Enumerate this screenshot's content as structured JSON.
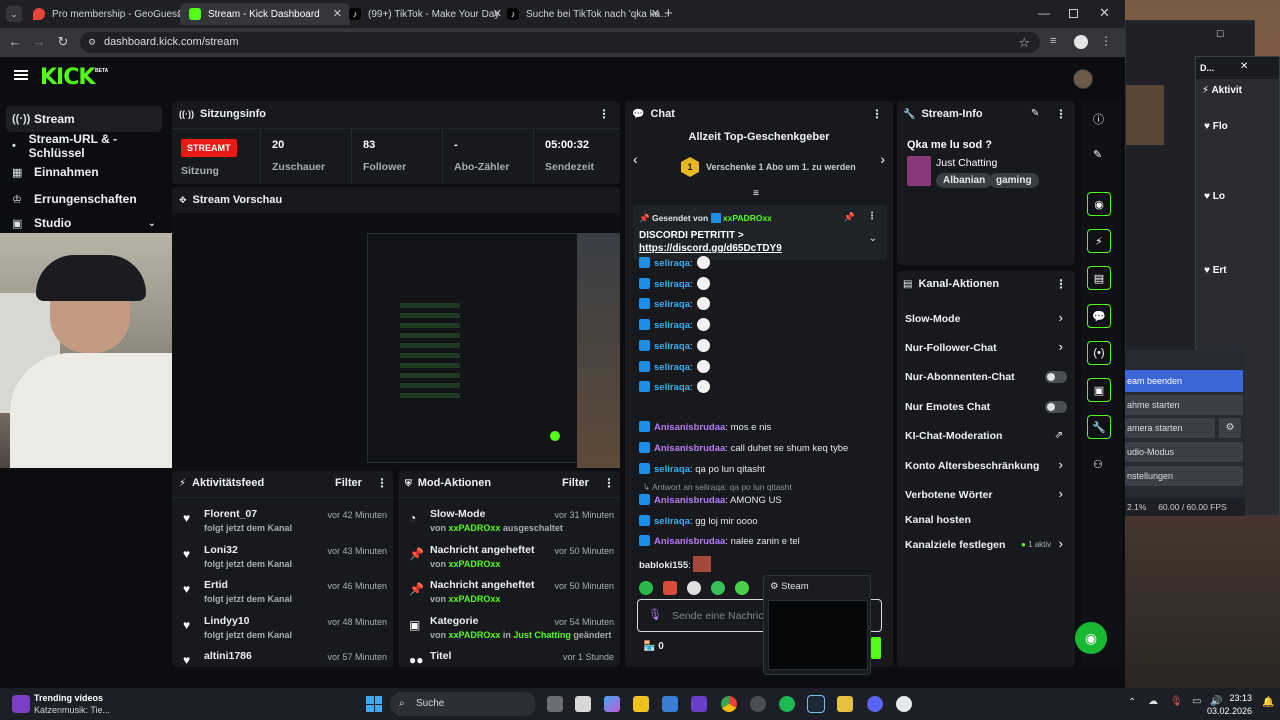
{
  "browser": {
    "tabs": [
      {
        "title": "Pro membership - GeoGuessr",
        "color": "#e8443a"
      },
      {
        "title": "Stream - Kick Dashboard",
        "color": "#53fc18"
      },
      {
        "title": "(99+) TikTok - Make Your Day",
        "color": "#111111"
      },
      {
        "title": "Suche bei TikTok nach 'qka ka…",
        "color": "#111111"
      }
    ],
    "url": "dashboard.kick.com/stream"
  },
  "kick": {
    "logo": "KICK",
    "beta": "BETA"
  },
  "nav": {
    "items": [
      "Stream",
      "Stream-URL & -Schlüssel",
      "Einnahmen",
      "Errungenschaften",
      "Studio"
    ]
  },
  "session": {
    "title": "Sitzungsinfo",
    "badge": "STREAMT",
    "sitzung": "Sitzung",
    "viewers": "20",
    "viewers_label": "Zuschauer",
    "followers": "83",
    "followers_label": "Follower",
    "subs": "-",
    "subs_label": "Abo-Zähler",
    "time": "05:00:32",
    "time_label": "Sendezeit"
  },
  "preview": {
    "title": "Stream Vorschau"
  },
  "activity": {
    "title": "Aktivitätsfeed",
    "filter": "Filter",
    "items": [
      {
        "name": "Florent_07",
        "sub": "folgt jetzt dem Kanal",
        "time": "vor 42 Minuten"
      },
      {
        "name": "Loni32",
        "sub": "folgt jetzt dem Kanal",
        "time": "vor 43 Minuten"
      },
      {
        "name": "Ertid",
        "sub": "folgt jetzt dem Kanal",
        "time": "vor 46 Minuten"
      },
      {
        "name": "Lindyy10",
        "sub": "folgt jetzt dem Kanal",
        "time": "vor 48 Minuten"
      },
      {
        "name": "altini1786",
        "sub": "",
        "time": "vor 57 Minuten"
      }
    ]
  },
  "mod": {
    "title": "Mod-Aktionen",
    "filter": "Filter",
    "items": [
      {
        "name": "Slow-Mode",
        "pre": "von ",
        "user": "xxPADROxx",
        "post": " ausgeschaltet",
        "extra": "",
        "time": "vor 31 Minuten"
      },
      {
        "name": "Nachricht angeheftet",
        "pre": "von ",
        "user": "xxPADROxx",
        "post": "",
        "extra": "",
        "time": "vor 50 Minuten"
      },
      {
        "name": "Nachricht angeheftet",
        "pre": "von ",
        "user": "xxPADROxx",
        "post": "",
        "extra": "",
        "time": "vor 50 Minuten"
      },
      {
        "name": "Kategorie",
        "pre": "von ",
        "user": "xxPADROxx",
        "post": " in ",
        "extra": "Just Chatting",
        "post2": " geändert",
        "time": "vor 54 Minuten"
      },
      {
        "name": "Titel",
        "pre": "",
        "user": "",
        "post": "",
        "extra": "",
        "time": "vor 1 Stunde"
      }
    ]
  },
  "chat": {
    "title": "Chat",
    "gifter_title": "Allzeit Top-Geschenkgeber",
    "gift_text": "Verschenke 1 Abo um 1. zu werden",
    "gift_rank": "1",
    "pinned_by": "Gesendet von",
    "pinned_user": "xxPADROxx",
    "pinned_msg": "DISCORDI PETRITIT >",
    "pinned_link": "https://discord.gg/d65DcTDY9",
    "messages": [
      {
        "user": "seliraqa",
        "text": "",
        "color": "blue",
        "emote": true
      },
      {
        "user": "seliraqa",
        "text": "",
        "color": "blue",
        "emote": true
      },
      {
        "user": "seliraqa",
        "text": "",
        "color": "blue",
        "emote": true
      },
      {
        "user": "seliraqa",
        "text": "",
        "color": "blue",
        "emote": true
      },
      {
        "user": "seliraqa",
        "text": "",
        "color": "blue",
        "emote": true
      },
      {
        "user": "seliraqa",
        "text": "",
        "color": "blue",
        "emote": true
      },
      {
        "user": "seliraqa",
        "text": "",
        "color": "blue",
        "emote": true
      },
      {
        "user": "Anisanisbrudaa",
        "text": "mos e nis",
        "color": "purple",
        "emote": false
      },
      {
        "user": "Anisanisbrudaa",
        "text": "call duhet se shum keq tybe",
        "color": "purple",
        "emote": false
      },
      {
        "user": "seliraqa",
        "text": "qa po lun qitasht",
        "color": "blue",
        "emote": false
      },
      {
        "user": "Anisanisbrudaa",
        "text": "AMONG US",
        "color": "purple",
        "emote": false
      },
      {
        "user": "seliraqa",
        "text": "gg loj mir oooo",
        "color": "blue",
        "emote": false
      },
      {
        "user": "Anisanisbrudaa",
        "text": "nalee zanin e tel",
        "color": "purple",
        "emote": false
      },
      {
        "user": "babloki155",
        "text": "",
        "color": "plain",
        "emote": false
      }
    ],
    "reply_hint": "Antwort an seliraqa: qa po lun qitasht",
    "input_placeholder": "Sende eine Nachricht",
    "count": "0"
  },
  "steam_popup": {
    "label": "Steam"
  },
  "info": {
    "title": "Stream-Info",
    "stream_title": "Qka me lu sod ?",
    "category": "Just Chatting",
    "tags": [
      "Albanian",
      "gaming"
    ]
  },
  "actions": {
    "title": "Kanal-Aktionen",
    "items": [
      {
        "label": "Slow-Mode",
        "kind": "chev"
      },
      {
        "label": "Nur-Follower-Chat",
        "kind": "chev"
      },
      {
        "label": "Nur-Abonnenten-Chat",
        "kind": "toggle"
      },
      {
        "label": "Nur Emotes Chat",
        "kind": "toggle"
      },
      {
        "label": "KI-Chat-Moderation",
        "kind": "ext"
      },
      {
        "label": "Konto Altersbeschränkung",
        "kind": "chev"
      },
      {
        "label": "Verbotene Wörter",
        "kind": "chev"
      },
      {
        "label": "Kanal hosten",
        "kind": "none"
      },
      {
        "label": "Kanalziele festlegen",
        "kind": "chev"
      }
    ],
    "goal_active": "1 aktiv"
  },
  "obs": {
    "title": "D...",
    "activity_label": "Aktivit",
    "list": [
      {
        "t": "Flo"
      },
      {
        "t": "Lo"
      },
      {
        "t": "Ert"
      }
    ],
    "buttons": [
      "eam beenden",
      "ahme starten",
      "amera starten",
      "udio-Modus",
      "nstellungen"
    ],
    "stats": "2.1%",
    "fps": "60.00 / 60.00 FPS"
  },
  "taskbar": {
    "weather_title": "Trending videos",
    "weather_sub": "Katzenmusik: Tie...",
    "search": "Suche",
    "time": "23:13",
    "date": "03.02.2026"
  }
}
